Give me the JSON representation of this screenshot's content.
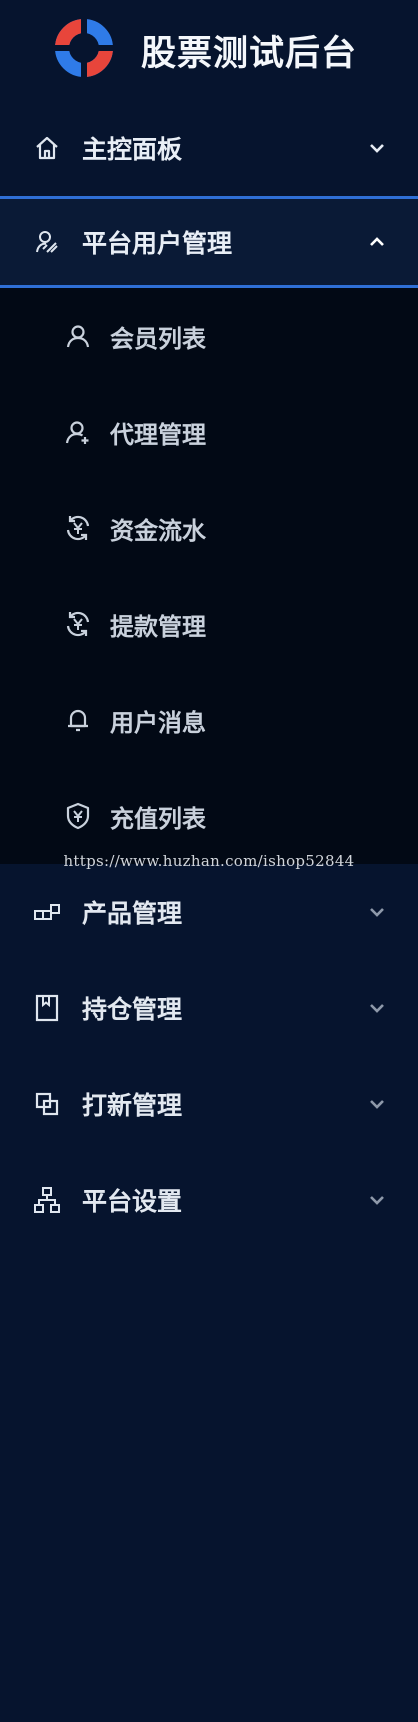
{
  "brand": {
    "title": "股票测试后台",
    "logo_colors": [
      "#e8453b",
      "#2f7be8"
    ]
  },
  "menu": {
    "dashboard": {
      "label": "主控面板",
      "icon": "home-icon"
    },
    "platform_users": {
      "label": "平台用户管理",
      "icon": "users-icon",
      "children": [
        {
          "label": "会员列表",
          "icon": "user-icon"
        },
        {
          "label": "代理管理",
          "icon": "user-plus-icon"
        },
        {
          "label": "资金流水",
          "icon": "money-cycle-icon"
        },
        {
          "label": "提款管理",
          "icon": "money-cycle-icon"
        },
        {
          "label": "用户消息",
          "icon": "bell-icon"
        },
        {
          "label": "充值列表",
          "icon": "shield-yen-icon"
        }
      ]
    },
    "products": {
      "label": "产品管理",
      "icon": "product-icon"
    },
    "positions": {
      "label": "持仓管理",
      "icon": "bookmark-icon"
    },
    "ipo": {
      "label": "打新管理",
      "icon": "copy-icon"
    },
    "settings": {
      "label": "平台设置",
      "icon": "sitemap-icon"
    }
  },
  "watermark": "https://www.huzhan.com/ishop52844",
  "colors": {
    "background": "#06142e",
    "accent": "#2f6fd6",
    "submenu_bg": "#020915"
  }
}
